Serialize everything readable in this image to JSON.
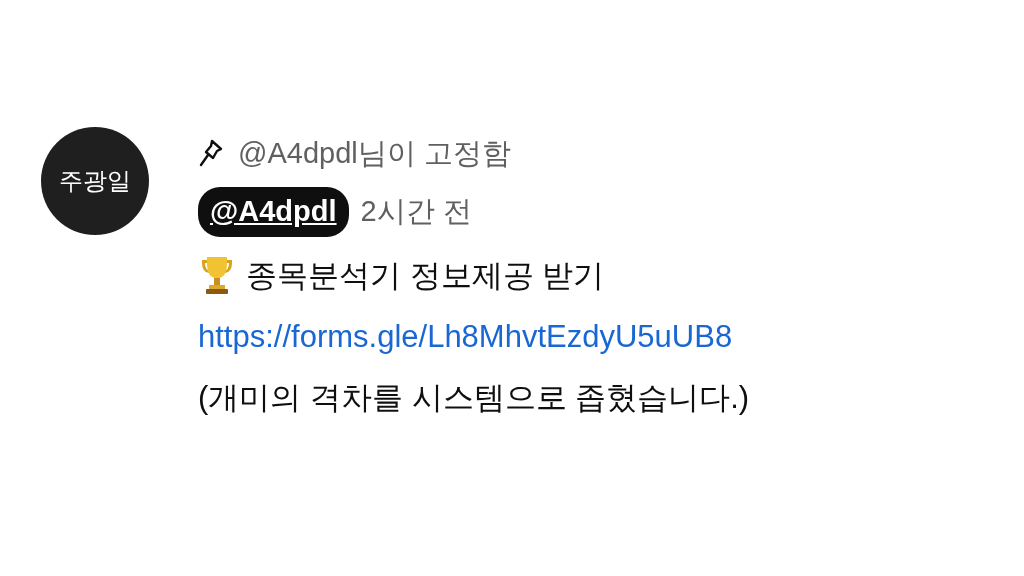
{
  "comment": {
    "avatar_text": "주광일",
    "pinned_label": "@A4dpdl님이 고정함",
    "author": "@A4dpdl",
    "time": "2시간 전",
    "body": [
      {
        "kind": "trophy_text",
        "text": "종목분석기 정보제공 받기"
      },
      {
        "kind": "link",
        "text": "https://forms.gle/Lh8MhvtEzdyU5uUB8"
      },
      {
        "kind": "text",
        "text": "(개미의 격차를 시스템으로 좁혔습니다.)"
      }
    ]
  }
}
